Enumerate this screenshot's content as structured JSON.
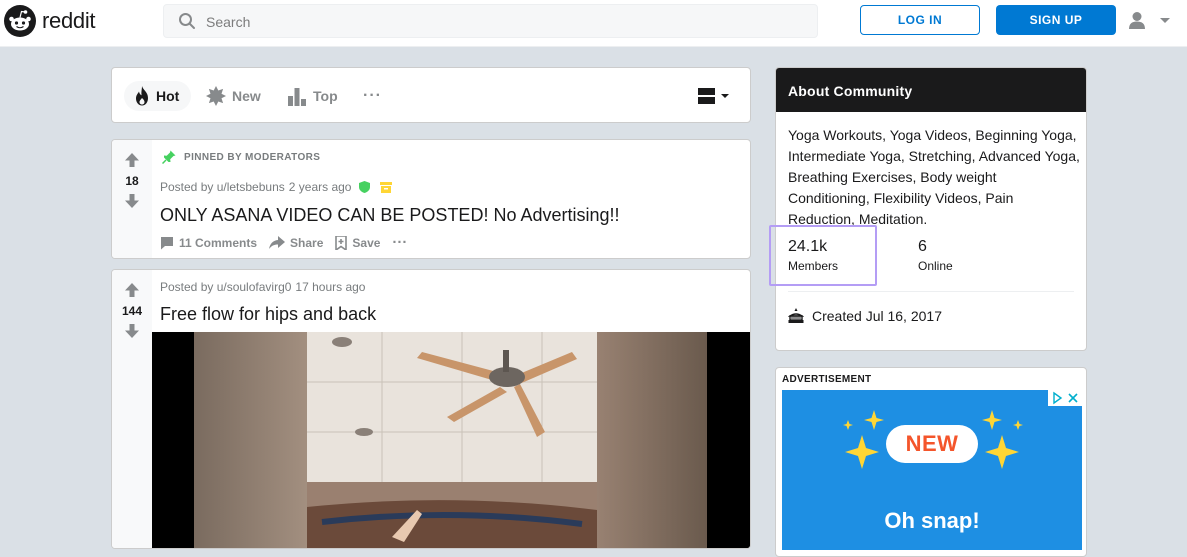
{
  "header": {
    "wordmark": "reddit",
    "search_placeholder": "Search",
    "login_label": "LOG IN",
    "signup_label": "SIGN UP"
  },
  "sort": {
    "hot": "Hot",
    "new": "New",
    "top": "Top",
    "more": "···"
  },
  "posts": [
    {
      "pinned_label": "PINNED BY MODERATORS",
      "score": "18",
      "posted_by": "Posted by u/letsbebuns",
      "age": "2 years ago",
      "title": "ONLY ASANA VIDEO CAN BE POSTED! No Advertising!!",
      "comments": "11 Comments",
      "share": "Share",
      "save": "Save",
      "more": "···"
    },
    {
      "score": "144",
      "posted_by": "Posted by u/soulofavirg0",
      "age": "17 hours ago",
      "title": "Free flow for hips and back"
    }
  ],
  "about": {
    "heading": "About Community",
    "description": "Yoga Workouts, Yoga Videos, Beginning Yoga, Intermediate Yoga, Stretching, Advanced Yoga, Breathing Exercises, Body weight Conditioning, Flexibility Videos, Pain Reduction, Meditation.",
    "members_count": "24.1k",
    "members_label": "Members",
    "online_count": "6",
    "online_label": "Online",
    "created": "Created Jul 16, 2017"
  },
  "ad": {
    "label": "ADVERTISEMENT",
    "badge": "NEW",
    "cta": "Oh snap!"
  },
  "colors": {
    "brand_blue": "#0079d3",
    "page_bg": "#dae0e6",
    "highlight": "#b49df5"
  }
}
